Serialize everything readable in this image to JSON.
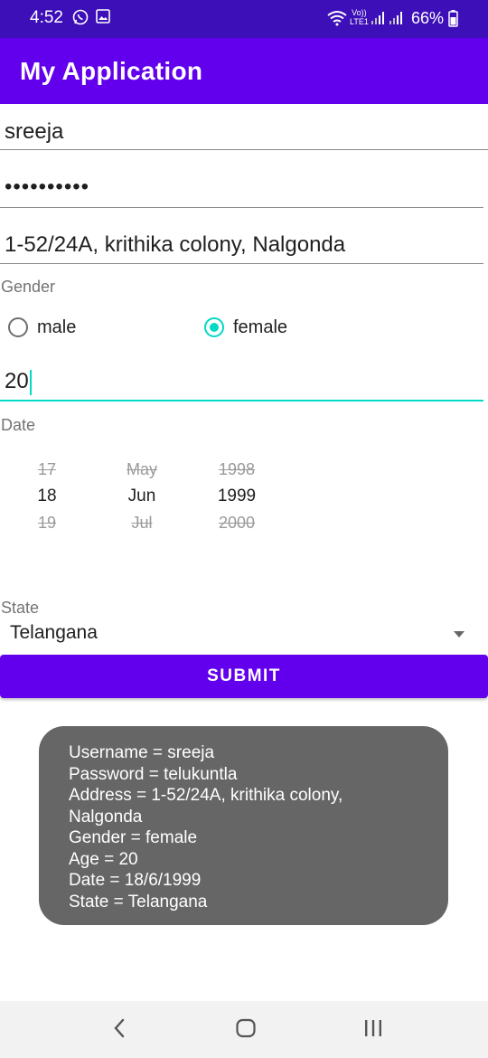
{
  "status_bar": {
    "time": "4:52",
    "battery": "66%",
    "icons": [
      "whatsapp-icon",
      "image-icon",
      "wifi-icon",
      "volte-icon",
      "signal-icon",
      "signal-icon",
      "battery-icon"
    ],
    "volte_label_top": "Vo))",
    "volte_label_bottom": "LTE1"
  },
  "app_bar": {
    "title": "My Application"
  },
  "form": {
    "username": "sreeja",
    "password_masked": "••••••••••",
    "address": "1-52/24A, krithika colony, Nalgonda",
    "gender_label": "Gender",
    "gender_options": [
      {
        "label": "male",
        "checked": false
      },
      {
        "label": "female",
        "checked": true
      }
    ],
    "age": "20",
    "date_label": "Date",
    "date_picker": {
      "day": {
        "prev": "17",
        "current": "18",
        "next": "19"
      },
      "month": {
        "prev": "May",
        "current": "Jun",
        "next": "Jul"
      },
      "year": {
        "prev": "1998",
        "current": "1999",
        "next": "2000"
      }
    },
    "state_label": "State",
    "state_value": "Telangana",
    "submit_label": "SUBMIT"
  },
  "toast": {
    "lines": [
      "Username = sreeja",
      "Password = telukuntla",
      "Address = 1-52/24A, krithika colony,",
      "Nalgonda",
      "Gender = female",
      "Age = 20",
      "Date = 18/6/1999",
      "State = Telangana"
    ]
  },
  "colors": {
    "status_bar": "#3d0fb8",
    "primary": "#6200ee",
    "accent": "#03dac5",
    "toast_bg": "#666666",
    "nav_bar": "#f2f2f2"
  }
}
